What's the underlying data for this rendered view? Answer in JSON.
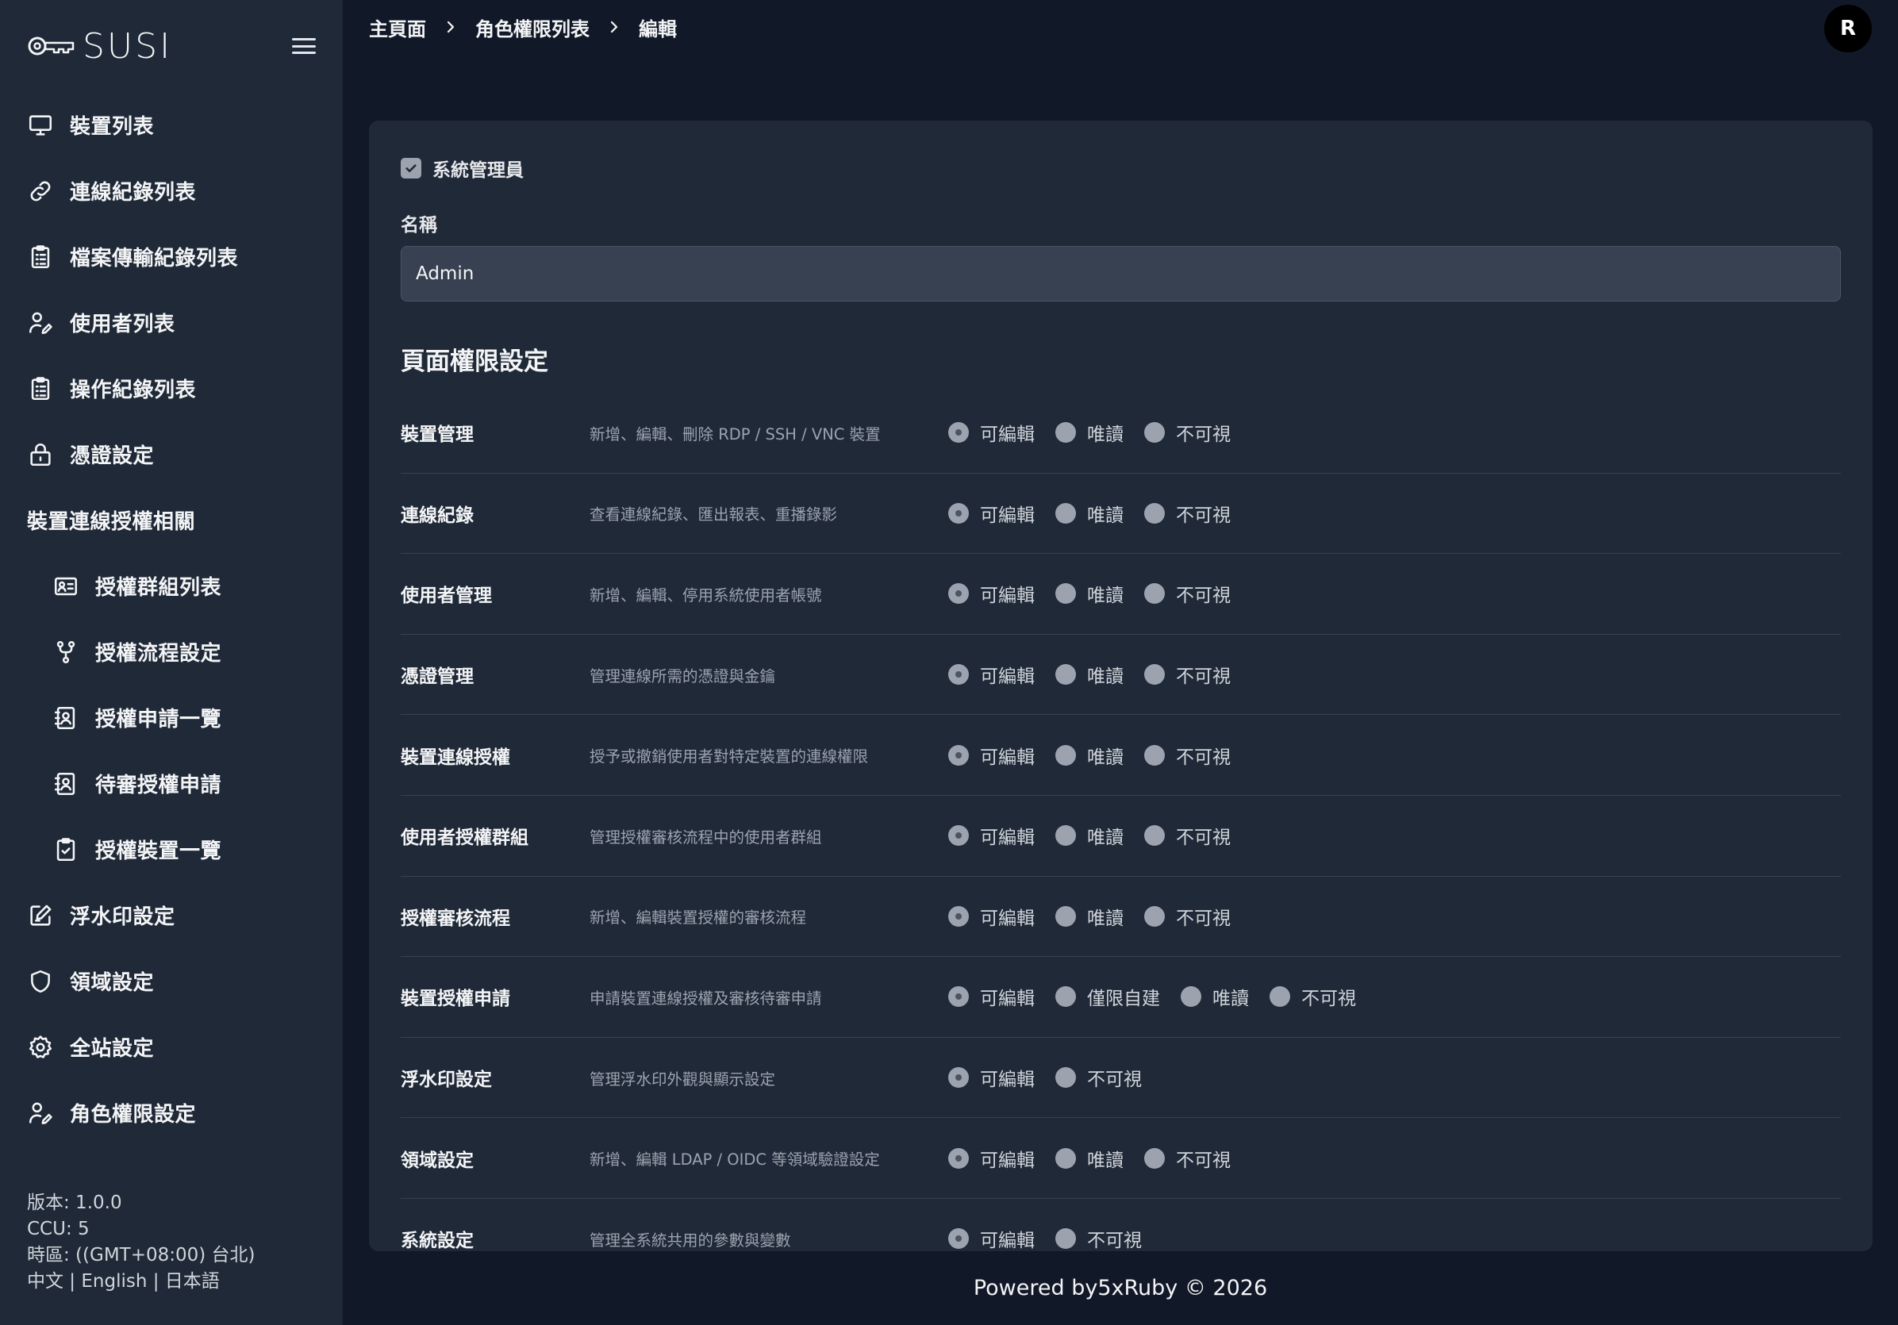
{
  "brand": {
    "name": "SUSI"
  },
  "sidebar": {
    "items": [
      {
        "label": "裝置列表",
        "icon": "monitor-icon"
      },
      {
        "label": "連線紀錄列表",
        "icon": "link-icon"
      },
      {
        "label": "檔案傳輸紀錄列表",
        "icon": "clipboard-list-icon"
      },
      {
        "label": "使用者列表",
        "icon": "user-edit-icon"
      },
      {
        "label": "操作紀錄列表",
        "icon": "clipboard-list-icon"
      },
      {
        "label": "憑證設定",
        "icon": "lock-icon"
      },
      {
        "label": "裝置連線授權相關",
        "icon": ""
      },
      {
        "label": "授權群組列表",
        "icon": "id-card-icon"
      },
      {
        "label": "授權流程設定",
        "icon": "branch-icon"
      },
      {
        "label": "授權申請一覽",
        "icon": "contact-book-icon"
      },
      {
        "label": "待審授權申請",
        "icon": "contact-book-icon"
      },
      {
        "label": "授權裝置一覽",
        "icon": "clipboard-check-icon"
      },
      {
        "label": "浮水印設定",
        "icon": "pen-square-icon"
      },
      {
        "label": "領域設定",
        "icon": "shield-icon"
      },
      {
        "label": "全站設定",
        "icon": "gear-icon"
      },
      {
        "label": "角色權限設定",
        "icon": "user-edit-icon"
      }
    ],
    "footer": {
      "version": "版本: 1.0.0",
      "ccu": "CCU: 5",
      "timezone": "時區: ((GMT+08:00) 台北)",
      "languages": "中文 | English | 日本語"
    }
  },
  "breadcrumb": [
    "主頁面",
    "角色權限列表",
    "編輯"
  ],
  "user": {
    "avatar_letter": "R"
  },
  "form": {
    "admin_label": "系統管理員",
    "admin_checked": true,
    "name_label": "名稱",
    "name_value": "Admin",
    "section_title": "頁面權限設定"
  },
  "permissions": [
    {
      "name": "裝置管理",
      "desc": "新增、編輯、刪除 RDP / SSH / VNC 裝置",
      "options": [
        "可編輯",
        "唯讀",
        "不可視"
      ],
      "selected": 0
    },
    {
      "name": "連線紀錄",
      "desc": "查看連線紀錄、匯出報表、重播錄影",
      "options": [
        "可編輯",
        "唯讀",
        "不可視"
      ],
      "selected": 0
    },
    {
      "name": "使用者管理",
      "desc": "新增、編輯、停用系統使用者帳號",
      "options": [
        "可編輯",
        "唯讀",
        "不可視"
      ],
      "selected": 0
    },
    {
      "name": "憑證管理",
      "desc": "管理連線所需的憑證與金鑰",
      "options": [
        "可編輯",
        "唯讀",
        "不可視"
      ],
      "selected": 0
    },
    {
      "name": "裝置連線授權",
      "desc": "授予或撤銷使用者對特定裝置的連線權限",
      "options": [
        "可編輯",
        "唯讀",
        "不可視"
      ],
      "selected": 0
    },
    {
      "name": "使用者授權群組",
      "desc": "管理授權審核流程中的使用者群組",
      "options": [
        "可編輯",
        "唯讀",
        "不可視"
      ],
      "selected": 0
    },
    {
      "name": "授權審核流程",
      "desc": "新增、編輯裝置授權的審核流程",
      "options": [
        "可編輯",
        "唯讀",
        "不可視"
      ],
      "selected": 0
    },
    {
      "name": "裝置授權申請",
      "desc": "申請裝置連線授權及審核待審申請",
      "options": [
        "可編輯",
        "僅限自建",
        "唯讀",
        "不可視"
      ],
      "selected": 0
    },
    {
      "name": "浮水印設定",
      "desc": "管理浮水印外觀與顯示設定",
      "options": [
        "可編輯",
        "不可視"
      ],
      "selected": 0
    },
    {
      "name": "領域設定",
      "desc": "新增、編輯 LDAP / OIDC 等領域驗證設定",
      "options": [
        "可編輯",
        "唯讀",
        "不可視"
      ],
      "selected": 0
    },
    {
      "name": "系統設定",
      "desc": "管理全系統共用的參數與變數",
      "options": [
        "可編輯",
        "不可視"
      ],
      "selected": 0
    }
  ],
  "footer": {
    "text": "Powered by5xRuby © 2026"
  },
  "colors": {
    "sidebar_bg": "#1f2937",
    "page_bg": "#111827",
    "card_bg": "#1f2937",
    "input_bg": "#374151",
    "radio": "#9ca3af"
  }
}
